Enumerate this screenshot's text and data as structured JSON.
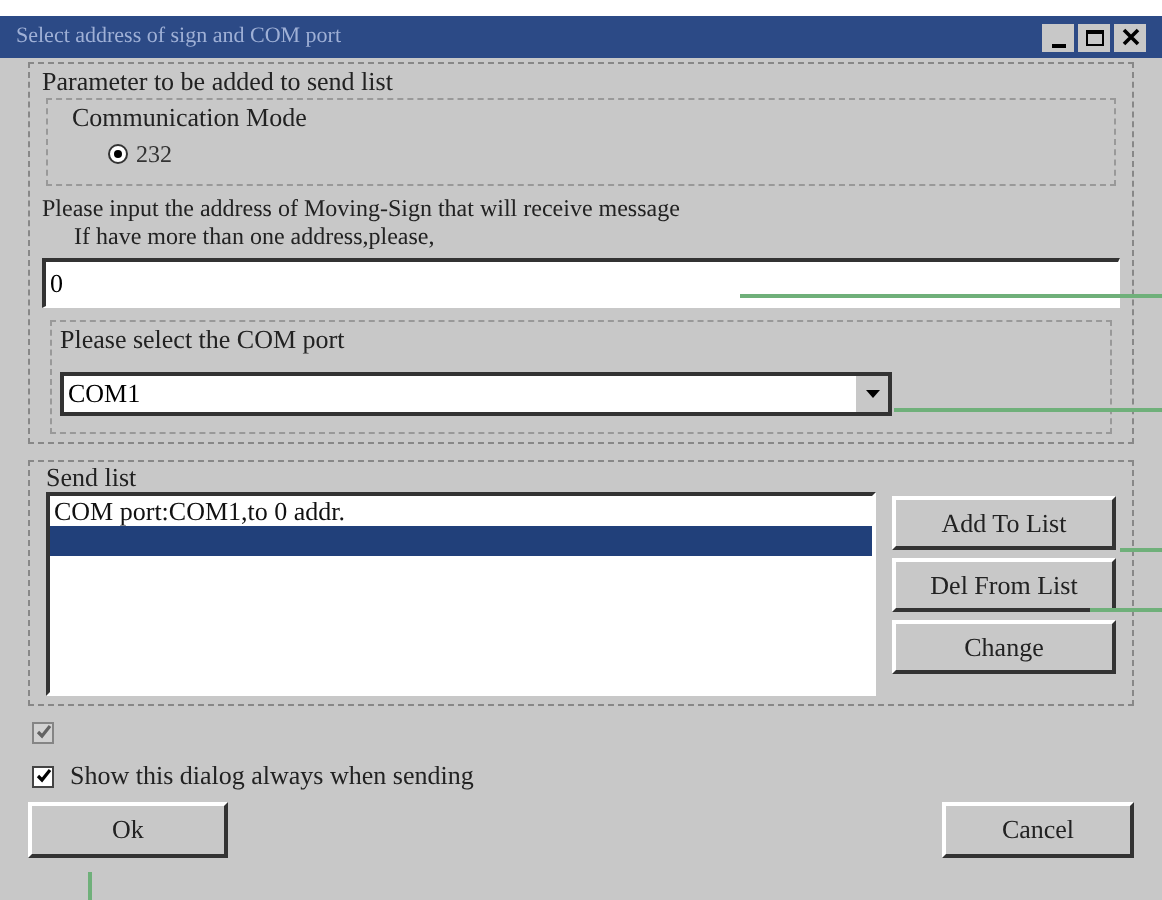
{
  "window": {
    "title": "Select address of sign and COM port"
  },
  "parameter_group": {
    "label": "Parameter to be added to send list",
    "mode_label": "Communication Mode",
    "modes": [
      {
        "label": "232",
        "selected": true
      }
    ]
  },
  "address": {
    "prompt": "Please input the address of Moving-Sign that will receive message",
    "hint": "If have more than one address,please,",
    "value": "0"
  },
  "com_group": {
    "label": "Please select the COM port",
    "value": "COM1"
  },
  "send_list": {
    "label": "Send list",
    "items": [
      {
        "label": "COM port:COM1,to 0 addr.",
        "selected": false
      },
      {
        "selected": true
      }
    ],
    "buttons": [
      "Add To List",
      "Del From List",
      "Change"
    ]
  },
  "options": [
    {
      "checked": true,
      "disabled": true
    },
    {
      "label": "Show this dialog always when sending",
      "checked": true,
      "disabled": false
    }
  ],
  "buttons": {
    "ok": "Ok",
    "cancel": "Cancel"
  }
}
